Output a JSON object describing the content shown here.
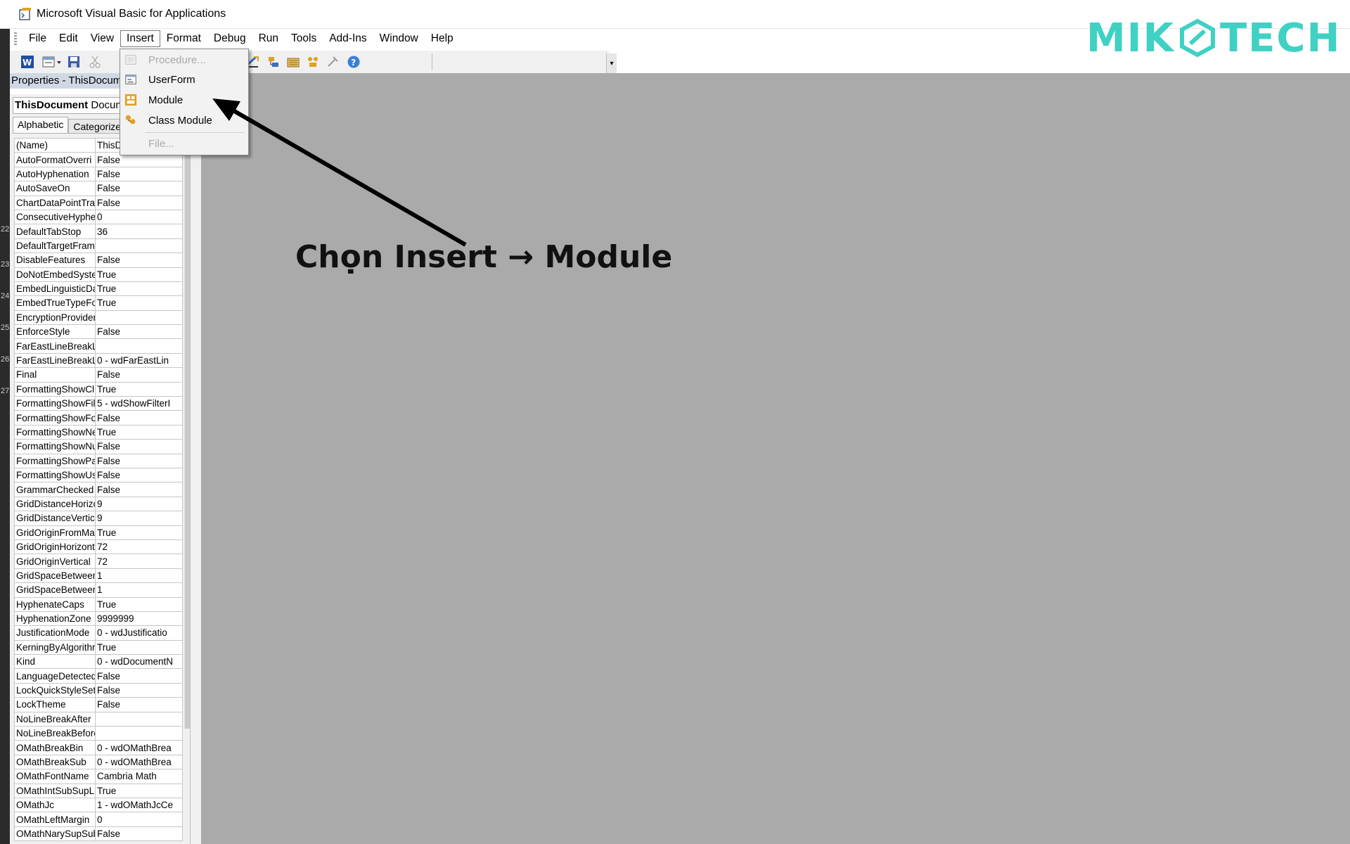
{
  "window": {
    "title": "Microsoft Visual Basic for Applications"
  },
  "menubar": {
    "items": [
      "File",
      "Edit",
      "View",
      "Insert",
      "Format",
      "Debug",
      "Run",
      "Tools",
      "Add-Ins",
      "Window",
      "Help"
    ],
    "active": "Insert"
  },
  "logo": {
    "left": "MIK",
    "right": "TECH",
    "color": "#3fd1c4"
  },
  "insert_menu": {
    "items": [
      {
        "label": "Procedure...",
        "enabled": false,
        "icon": "procedure-icon"
      },
      {
        "label": "UserForm",
        "enabled": true,
        "icon": "userform-icon"
      },
      {
        "label": "Module",
        "enabled": true,
        "icon": "module-icon"
      },
      {
        "label": "Class Module",
        "enabled": true,
        "icon": "class-module-icon"
      },
      {
        "label": "File...",
        "enabled": false,
        "icon": ""
      }
    ]
  },
  "properties": {
    "header": "Properties - ThisDocum",
    "object_name": "ThisDocument",
    "object_type": "Docum",
    "tabs": [
      "Alphabetic",
      "Categorize"
    ],
    "rows": [
      [
        "(Name)",
        "ThisD"
      ],
      [
        "AutoFormatOverri",
        "False"
      ],
      [
        "AutoHyphenation",
        "False"
      ],
      [
        "AutoSaveOn",
        "False"
      ],
      [
        "ChartDataPointTra",
        "False"
      ],
      [
        "ConsecutiveHyphe",
        "0"
      ],
      [
        "DefaultTabStop",
        "36"
      ],
      [
        "DefaultTargetFram",
        ""
      ],
      [
        "DisableFeatures",
        "False"
      ],
      [
        "DoNotEmbedSyste",
        "True"
      ],
      [
        "EmbedLinguisticDa",
        "True"
      ],
      [
        "EmbedTrueTypeFo",
        "True"
      ],
      [
        "EncryptionProvider",
        ""
      ],
      [
        "EnforceStyle",
        "False"
      ],
      [
        "FarEastLineBreakL",
        ""
      ],
      [
        "FarEastLineBreakL",
        "0 - wdFarEastLin"
      ],
      [
        "Final",
        "False"
      ],
      [
        "FormattingShowCl",
        "True"
      ],
      [
        "FormattingShowFil",
        "5 - wdShowFilterI"
      ],
      [
        "FormattingShowFo",
        "False"
      ],
      [
        "FormattingShowNe",
        "True"
      ],
      [
        "FormattingShowNu",
        "False"
      ],
      [
        "FormattingShowPa",
        "False"
      ],
      [
        "FormattingShowUs",
        "False"
      ],
      [
        "GrammarChecked",
        "False"
      ],
      [
        "GridDistanceHorizo",
        "9"
      ],
      [
        "GridDistanceVertic",
        "9"
      ],
      [
        "GridOriginFromMar",
        "True"
      ],
      [
        "GridOriginHorizont",
        "72"
      ],
      [
        "GridOriginVertical",
        "72"
      ],
      [
        "GridSpaceBetween",
        "1"
      ],
      [
        "GridSpaceBetween",
        "1"
      ],
      [
        "HyphenateCaps",
        "True"
      ],
      [
        "HyphenationZone",
        "9999999"
      ],
      [
        "JustificationMode",
        "0 - wdJustificatio"
      ],
      [
        "KerningByAlgorithr",
        "True"
      ],
      [
        "Kind",
        "0 - wdDocumentN"
      ],
      [
        "LanguageDetected",
        "False"
      ],
      [
        "LockQuickStyleSet",
        "False"
      ],
      [
        "LockTheme",
        "False"
      ],
      [
        "NoLineBreakAfter",
        ""
      ],
      [
        "NoLineBreakBefore",
        ""
      ],
      [
        "OMathBreakBin",
        "0 - wdOMathBrea"
      ],
      [
        "OMathBreakSub",
        "0 - wdOMathBrea"
      ],
      [
        "OMathFontName",
        "Cambria Math"
      ],
      [
        "OMathIntSubSupLi",
        "True"
      ],
      [
        "OMathJc",
        "1 - wdOMathJcCe"
      ],
      [
        "OMathLeftMargin",
        "0"
      ],
      [
        "OMathNarySupSub",
        "False"
      ]
    ]
  },
  "ruler": {
    "numbers": [
      "22",
      "23",
      "24",
      "25",
      "26",
      "27"
    ]
  },
  "annotation": {
    "text": "Chọn Insert → Module"
  }
}
